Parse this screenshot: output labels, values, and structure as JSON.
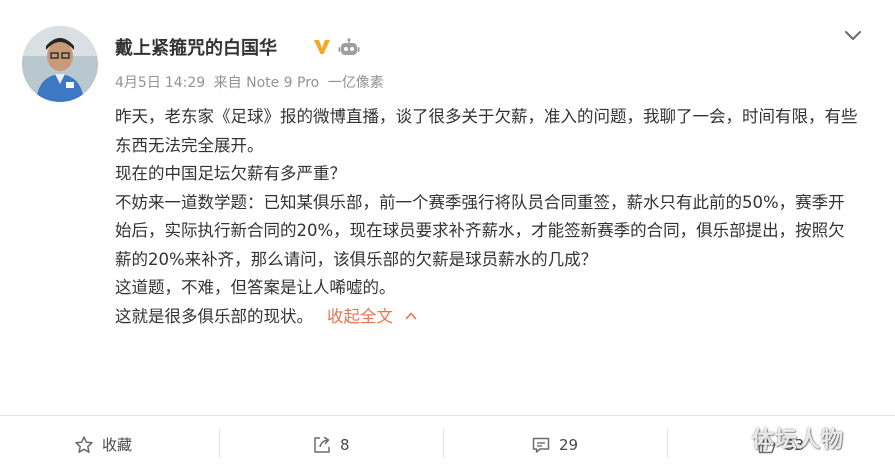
{
  "post": {
    "author": {
      "name": "戴上紧箍咒的白国华",
      "avatar_icon": "user-avatar",
      "verified_icon": "verified-v-icon",
      "member_icon": "robot-badge-icon",
      "verified_color": "#f5a623"
    },
    "meta": {
      "date": "4月5日",
      "time": "14:29",
      "source": "来自 Note 9 Pro",
      "device": "一亿像素"
    },
    "body": {
      "p1": "昨天，老东家《足球》报的微博直播，谈了很多关于欠薪，准入的问题，我聊了一会，时间有限，有些东西无法完全展开。",
      "p2": "现在的中国足坛欠薪有多严重？",
      "p3": "不妨来一道数学题：已知某俱乐部，前一个赛季强行将队员合同重签，薪水只有此前的50%，赛季开始后，实际执行新合同的20%，现在球员要求补齐薪水，才能签新赛季的合同，俱乐部提出，按照欠薪的20%来补齐，那么请问，该俱乐部的欠薪是球员薪水的几成？",
      "p4": "这道题，不难，但答案是让人唏嘘的。",
      "p5": "这就是很多俱乐部的现状。",
      "collapse_label": "收起全文",
      "link_color": "#eb7350"
    },
    "actions": {
      "favorite_label": "收藏",
      "repost_count": "8",
      "comment_count": "29",
      "like_count": "33"
    },
    "watermark": "体坛人物"
  }
}
